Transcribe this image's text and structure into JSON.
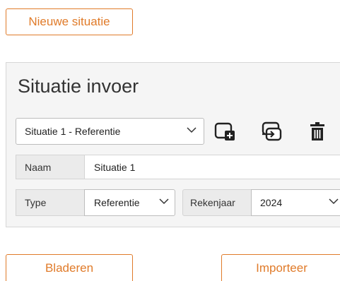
{
  "top_button": {
    "label": "Nieuwe situatie"
  },
  "panel": {
    "title": "Situatie invoer",
    "situation_select": {
      "value": "Situatie 1 - Referentie"
    },
    "toolbar": {
      "add_icon": "add-window-icon",
      "copy_icon": "copy-swap-icon",
      "delete_icon": "trash-icon"
    },
    "name": {
      "label": "Naam",
      "value": "Situatie 1"
    },
    "type": {
      "label": "Type",
      "value": "Referentie"
    },
    "year": {
      "label": "Rekenjaar",
      "value": "2024"
    }
  },
  "bottom_buttons": {
    "browse_label": "Bladeren",
    "import_label": "Importeer"
  },
  "colors": {
    "accent": "#e07b2a",
    "panel_bg": "#f5f5f5",
    "label_bg": "#ebebeb",
    "border": "#d4d4d4"
  }
}
